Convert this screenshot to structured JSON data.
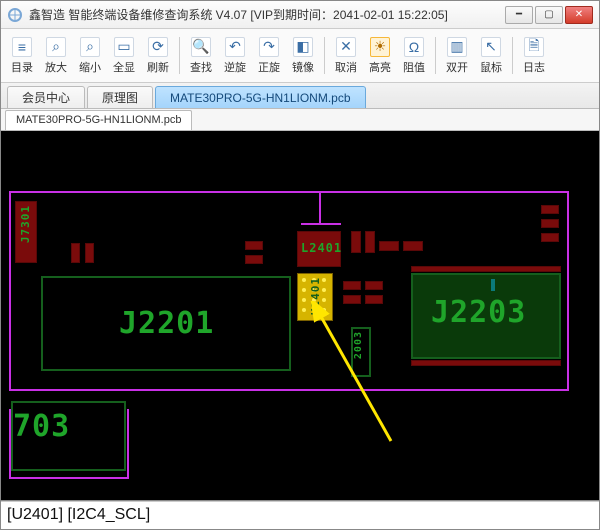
{
  "window": {
    "title": "鑫智造 智能终端设备维修查询系统 V4.07 [VIP到期时间：2041-02-01 15:22:05]"
  },
  "toolbar": {
    "items": [
      {
        "label": "目录",
        "icon": "≡"
      },
      {
        "label": "放大",
        "icon": "⌕"
      },
      {
        "label": "缩小",
        "icon": "⌕"
      },
      {
        "label": "全显",
        "icon": "▭"
      },
      {
        "label": "刷新",
        "icon": "⟳"
      },
      {
        "label": "查找",
        "icon": "🔍"
      },
      {
        "label": "逆旋",
        "icon": "↶"
      },
      {
        "label": "正旋",
        "icon": "↷"
      },
      {
        "label": "镜像",
        "icon": "◧"
      },
      {
        "label": "取消",
        "icon": "✕"
      },
      {
        "label": "高亮",
        "icon": "☀"
      },
      {
        "label": "阻值",
        "icon": "Ω"
      },
      {
        "label": "双开",
        "icon": "▥"
      },
      {
        "label": "鼠标",
        "icon": "↖"
      },
      {
        "label": "日志",
        "icon": "🗎"
      }
    ]
  },
  "tabs": {
    "items": [
      {
        "label": "会员中心"
      },
      {
        "label": "原理图"
      },
      {
        "label": "MATE30PRO-5G-HN1LIONM.pcb"
      }
    ],
    "active": 2
  },
  "filetab": {
    "label": "MATE30PRO-5G-HN1LIONM.pcb"
  },
  "board": {
    "labels": {
      "J2201": "J2201",
      "J2203": "J2203",
      "seven03": "703",
      "J7301": "J7301",
      "L2401": "L2401",
      "U2401": "U2401",
      "sm2003": "2003"
    }
  },
  "status": {
    "text": "[U2401] [I2C4_SCL]"
  }
}
